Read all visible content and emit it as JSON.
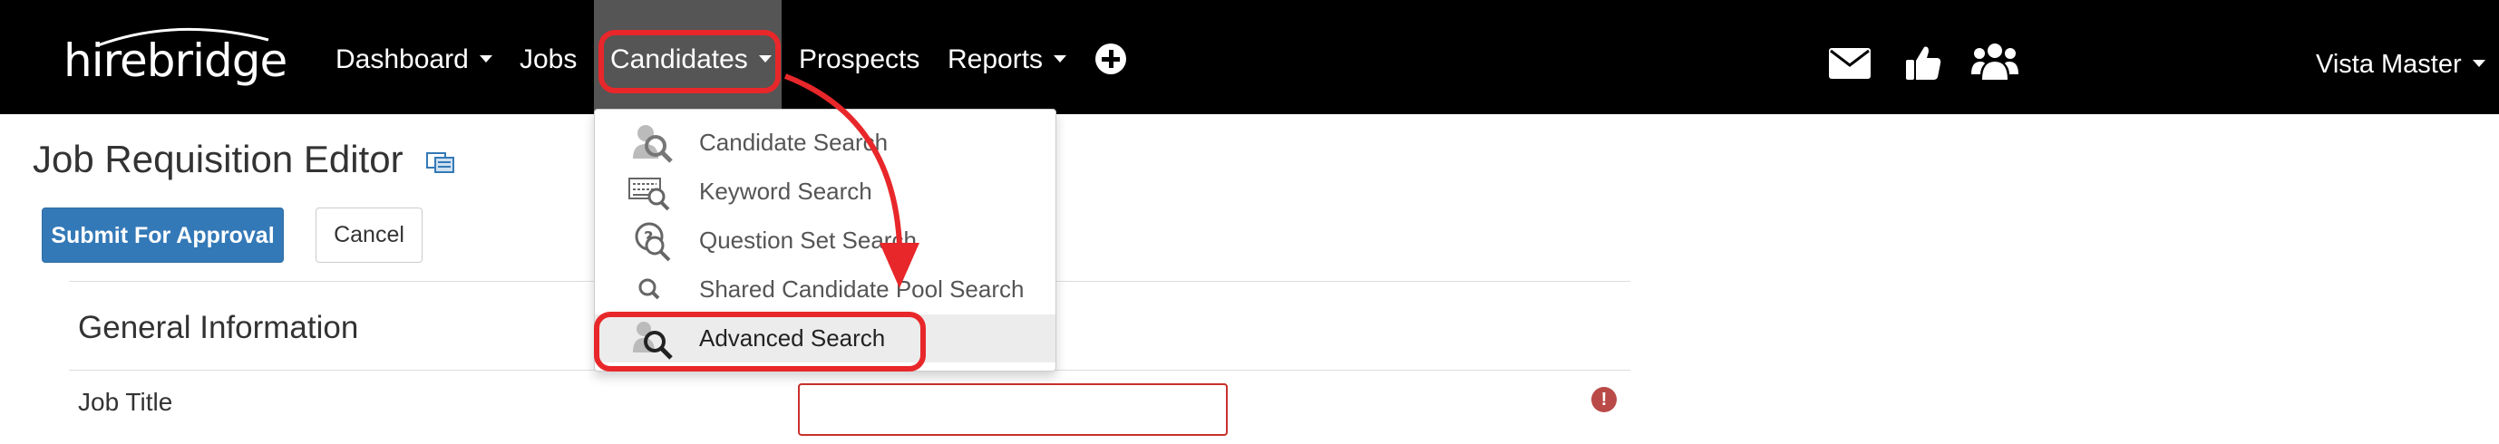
{
  "brand": {
    "logo_text": "hirebridge"
  },
  "nav": {
    "dashboard": "Dashboard",
    "jobs": "Jobs",
    "candidates": "Candidates",
    "prospects": "Prospects",
    "reports": "Reports",
    "user": "Vista Master"
  },
  "nav_icons": [
    "plus-circle-icon",
    "envelope-icon",
    "thumbs-up-icon",
    "users-icon"
  ],
  "page": {
    "title": "Job Requisition Editor",
    "submit_button": "Submit For Approval",
    "cancel_button": "Cancel",
    "section_title": "General Information",
    "job_title_label": "Job Title",
    "job_title_value": "",
    "required_indicator": "!"
  },
  "candidates_menu": {
    "items": [
      {
        "label": "Candidate Search",
        "icon": "candidate-search-icon"
      },
      {
        "label": "Keyword Search",
        "icon": "keyword-search-icon"
      },
      {
        "label": "Question Set Search",
        "icon": "question-set-search-icon"
      },
      {
        "label": "Shared Candidate Pool Search",
        "icon": "magnifier-icon"
      },
      {
        "label": "Advanced Search",
        "icon": "advanced-search-icon",
        "active": true
      }
    ]
  },
  "colors": {
    "navbar": "#000000",
    "nav_active": "#555555",
    "primary_button": "#3479b7",
    "annotation_red": "#e8272a",
    "required": "#b94a48"
  }
}
